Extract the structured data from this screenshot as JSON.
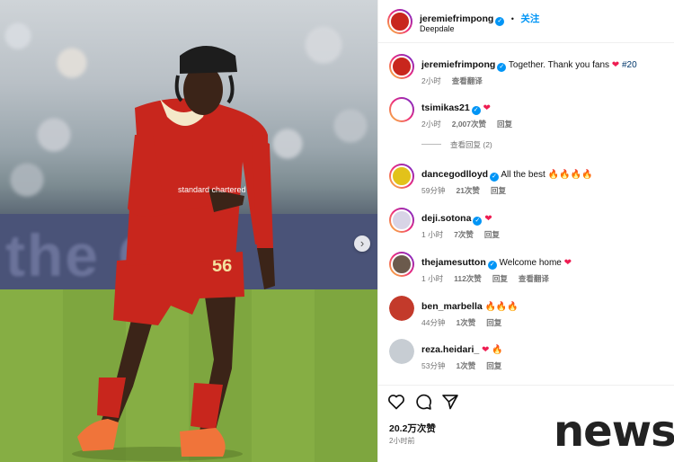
{
  "post": {
    "author": "jeremiefrimpong",
    "follow_label": "关注",
    "location": "Deepdale",
    "caption_text": "Together. Thank you fans",
    "caption_hashtag": "#20",
    "caption_time": "2小时",
    "caption_translate": "查看翻译"
  },
  "photo": {
    "board_text": "the Cl",
    "shirt_number": "56",
    "sponsor": "standard chartered",
    "next_icon": "chevron-right-icon"
  },
  "comments": [
    {
      "user": "tsimikas21",
      "verified": true,
      "text": "",
      "emoji": "heart",
      "time": "2小时",
      "likes": "2,007次赞",
      "reply": "回复",
      "translate": "",
      "avatar_color": "#ffffff",
      "more_replies": "查看回复 (2)"
    },
    {
      "user": "dancegodlloyd",
      "verified": true,
      "text": "All the best",
      "emoji": "fire x4",
      "time": "59分钟",
      "likes": "21次赞",
      "reply": "回复",
      "translate": "",
      "avatar_color": "#e2c21a"
    },
    {
      "user": "deji.sotona",
      "verified": true,
      "text": "",
      "emoji": "heart",
      "time": "1 小时",
      "likes": "7次赞",
      "reply": "回复",
      "translate": "",
      "avatar_color": "#d8d4e6"
    },
    {
      "user": "thejamesutton",
      "verified": true,
      "text": "Welcome home",
      "emoji": "heart",
      "time": "1 小时",
      "likes": "112次赞",
      "reply": "回复",
      "translate": "查看翻译",
      "avatar_color": "#6b5a4c"
    },
    {
      "user": "ben_marbella",
      "verified": false,
      "text": "",
      "emoji": "fire x3",
      "time": "44分钟",
      "likes": "1次赞",
      "reply": "回复",
      "translate": "",
      "avatar_color": "#c33a2b"
    },
    {
      "user": "reza.heidari_",
      "verified": false,
      "text": "",
      "emoji": "heart fire",
      "time": "53分钟",
      "likes": "1次赞",
      "reply": "回复",
      "translate": "",
      "avatar_color": "#c7cdd3"
    }
  ],
  "actions": {
    "icons": [
      "heart-icon",
      "comment-icon",
      "share-icon"
    ],
    "like_count": "20.2万次赞",
    "posted": "2小时前"
  },
  "watermark": "news",
  "colors": {
    "accent": "#0095f6",
    "heart": "#ee1d52",
    "kit": "#c8261d"
  }
}
